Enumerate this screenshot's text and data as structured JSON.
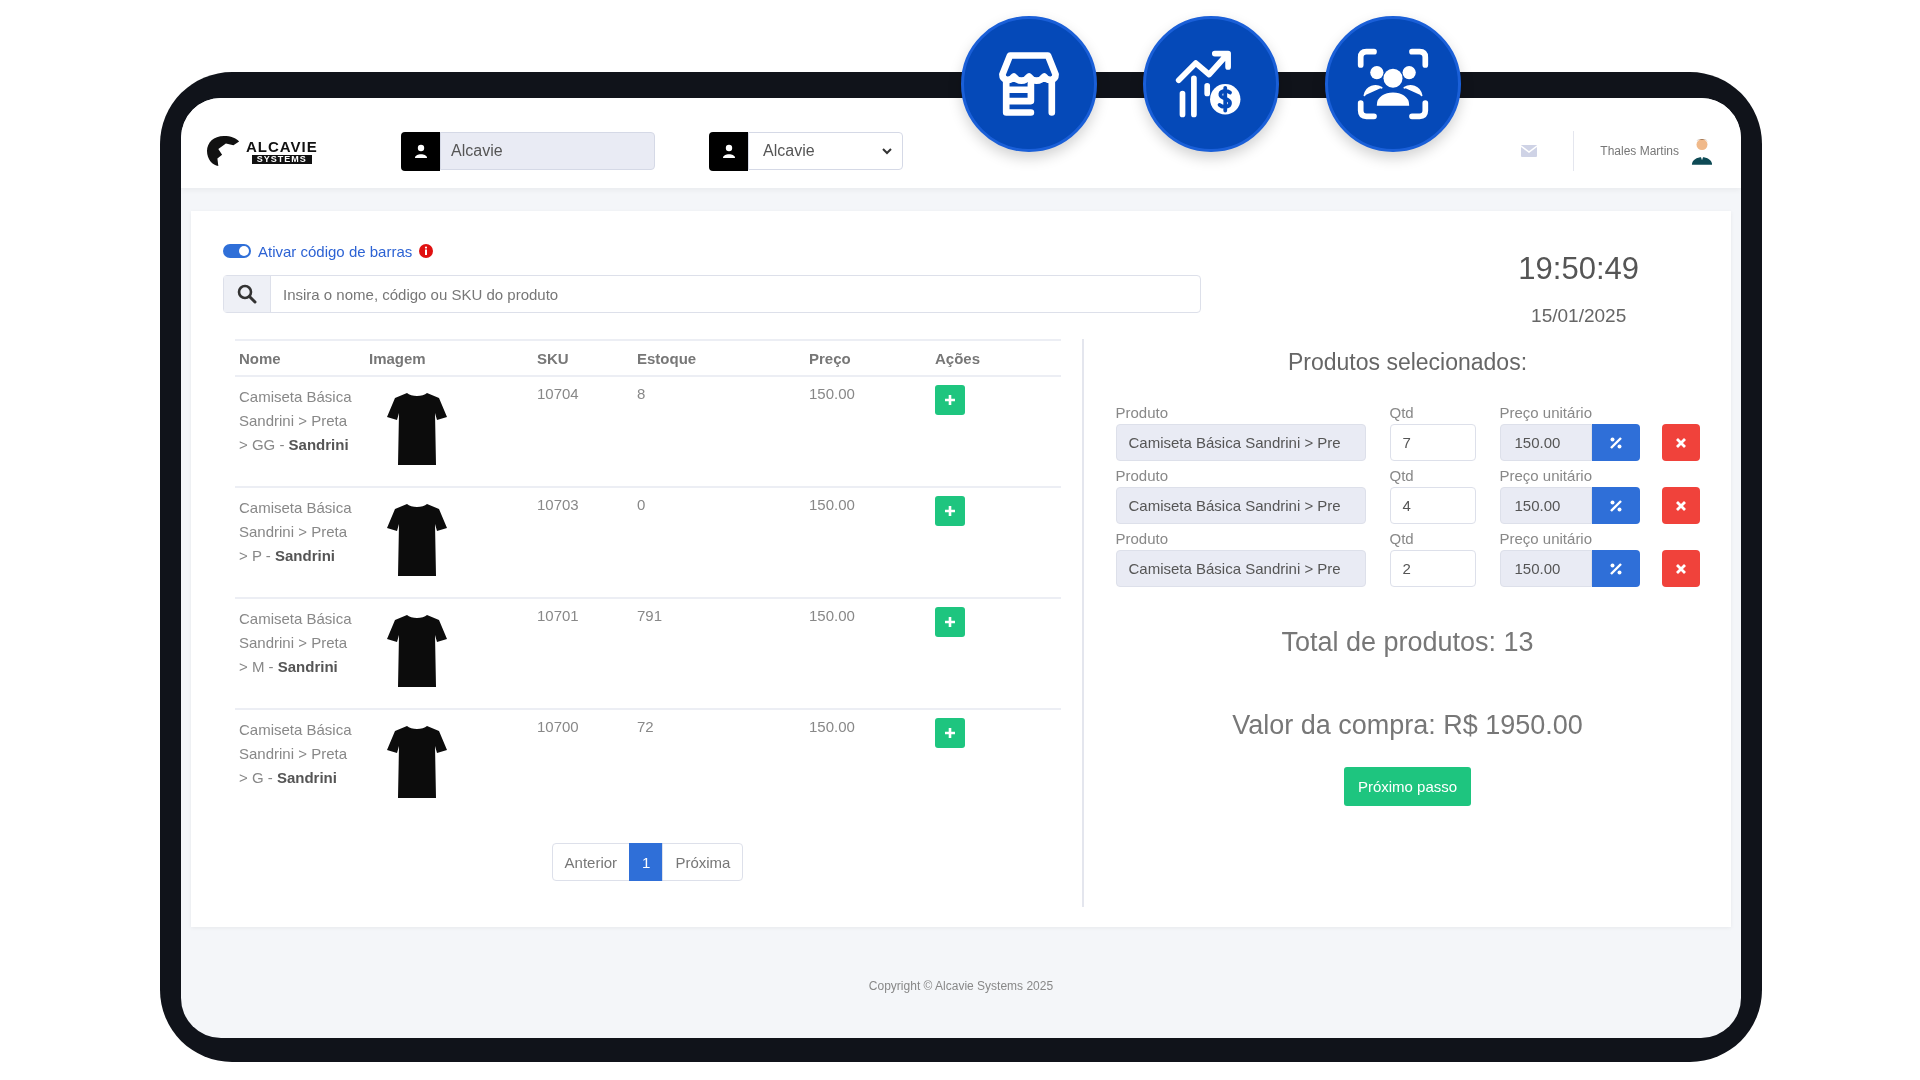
{
  "logo": {
    "name": "ALCAVIE",
    "tagline": "SYSTEMS"
  },
  "header": {
    "company_field": {
      "value": "Alcavie"
    },
    "store_select": {
      "value": "Alcavie"
    },
    "user": {
      "name": "Thales Martins"
    }
  },
  "barcode_toggle": {
    "label": "Ativar código de barras",
    "on": true
  },
  "search": {
    "placeholder": "Insira o nome, código ou SKU do produto"
  },
  "table": {
    "columns": [
      "Nome",
      "Imagem",
      "SKU",
      "Estoque",
      "Preço",
      "Ações"
    ],
    "rows": [
      {
        "name": "Camiseta Básica Sandrini > Preta > GG - **Sandrini**",
        "sku": "10704",
        "stock": "8",
        "price": "150.00"
      },
      {
        "name": "Camiseta Básica Sandrini > Preta > P - **Sandrini**",
        "sku": "10703",
        "stock": "0",
        "price": "150.00"
      },
      {
        "name": "Camiseta Básica Sandrini > Preta > M - **Sandrini**",
        "sku": "10701",
        "stock": "791",
        "price": "150.00"
      },
      {
        "name": "Camiseta Básica Sandrini > Preta > G - **Sandrini**",
        "sku": "10700",
        "stock": "72",
        "price": "150.00"
      }
    ]
  },
  "pagination": {
    "previous": "Anterior",
    "pages": [
      {
        "label": "1",
        "selected": true
      }
    ],
    "next": "Próxima"
  },
  "clock": {
    "time": "19:50:49",
    "date": "15/01/2025"
  },
  "selected_products": {
    "title": "Produtos selecionados:",
    "items": [
      {
        "product_label": "Produto",
        "product": "Camiseta Básica Sandrini > Pre",
        "qty_label": "Qtd",
        "qty": "7",
        "price_label": "Preço unitário",
        "price": "150.00"
      },
      {
        "product_label": "Produto",
        "product": "Camiseta Básica Sandrini > Pre",
        "qty_label": "Qtd",
        "qty": "4",
        "price_label": "Preço unitário",
        "price": "150.00"
      },
      {
        "product_label": "Produto",
        "product": "Camiseta Básica Sandrini > Pre",
        "qty_label": "Qtd",
        "qty": "2",
        "price_label": "Preço unitário",
        "price": "150.00"
      }
    ]
  },
  "total_products": "Total de produtos: 13",
  "purchase_value": "Valor da compra: R$ 1950.00",
  "next_button": "Próximo passo",
  "footer": "Copyright © Alcavie Systems 2025"
}
